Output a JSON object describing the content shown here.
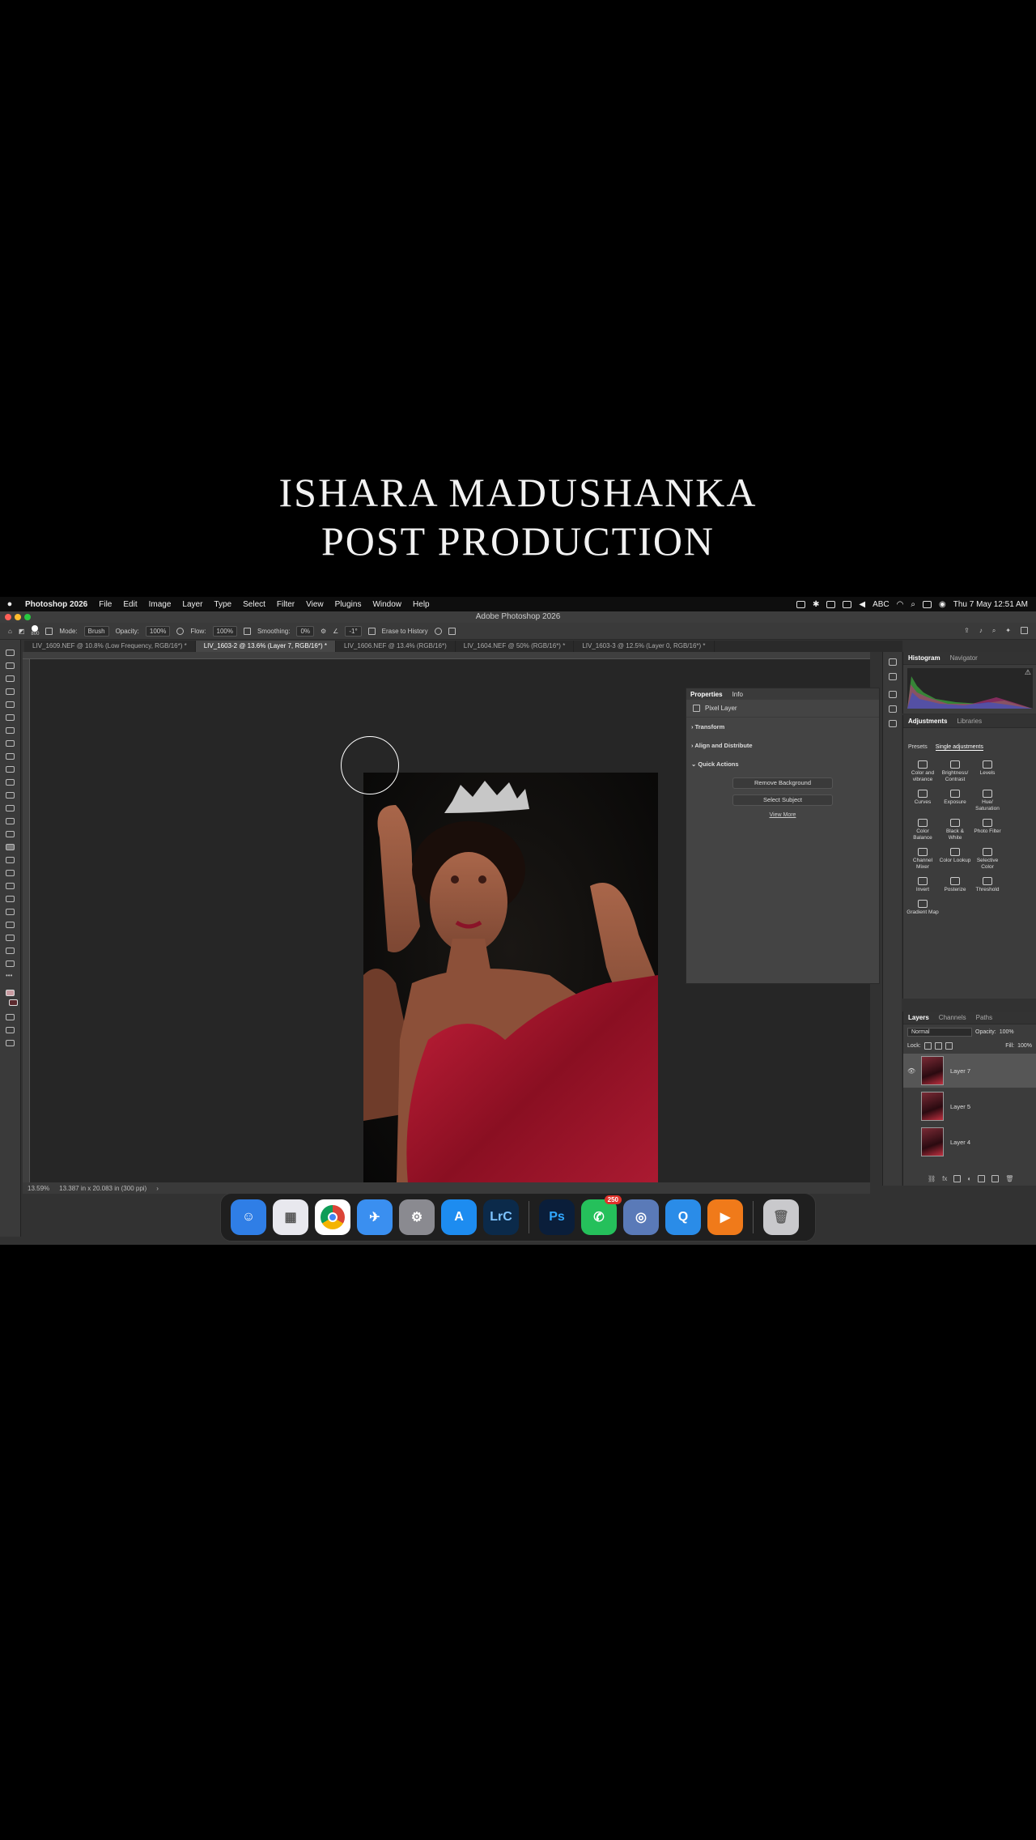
{
  "overlay": {
    "line1": "ISHARA MADUSHANKA",
    "line2": "POST PRODUCTION"
  },
  "menubar": {
    "app": "Photoshop 2026",
    "items": [
      "File",
      "Edit",
      "Image",
      "Layer",
      "Type",
      "Select",
      "Filter",
      "View",
      "Plugins",
      "Window",
      "Help"
    ],
    "status": {
      "abc": "ABC",
      "datetime": "Thu 7 May  12:51 AM"
    }
  },
  "window": {
    "title": "Adobe Photoshop 2026"
  },
  "options": {
    "brush_size": "800",
    "mode_label": "Mode:",
    "mode_value": "Brush",
    "opacity_label": "Opacity:",
    "opacity_value": "100%",
    "flow_label": "Flow:",
    "flow_value": "100%",
    "smoothing_label": "Smoothing:",
    "smoothing_value": "0%",
    "angle_value": "-1°",
    "erase_history": "Erase to History"
  },
  "tabs": [
    {
      "label": "LIV_1609.NEF @ 10.8% (Low Frequency, RGB/16*) *"
    },
    {
      "label": "LIV_1603-2 @ 13.6% (Layer 7, RGB/16*) *"
    },
    {
      "label": "LIV_1606.NEF @ 13.4% (RGB/16*)"
    },
    {
      "label": "LIV_1604.NEF @ 50% (RGB/16*) *"
    },
    {
      "label": "LIV_1603-3 @ 12.5% (Layer 0, RGB/16*) *"
    }
  ],
  "status": {
    "zoom": "13.59%",
    "doc_size": "13.387 in x 20.083 in (300 ppi)"
  },
  "properties": {
    "tab_properties": "Properties",
    "tab_info": "Info",
    "pixel_layer": "Pixel Layer",
    "transform": "Transform",
    "align": "Align and Distribute",
    "quick_actions": "Quick Actions",
    "remove_bg": "Remove Background",
    "select_subject": "Select Subject",
    "view_more": "View More"
  },
  "histogram": {
    "tab_histogram": "Histogram",
    "tab_navigator": "Navigator"
  },
  "adjustments": {
    "tab_adjustments": "Adjustments",
    "tab_libraries": "Libraries",
    "presets": "Presets",
    "single": "Single adjustments",
    "items": [
      "Color and vibrance",
      "Brightness/ Contrast",
      "Levels",
      "Curves",
      "Exposure",
      "Hue/ Saturation",
      "Color Balance",
      "Black & White",
      "Photo Filter",
      "Channel Mixer",
      "Color Lookup",
      "Selective Color",
      "Invert",
      "Posterize",
      "Threshold",
      "Gradient Map"
    ]
  },
  "layers": {
    "tab_layers": "Layers",
    "tab_channels": "Channels",
    "tab_paths": "Paths",
    "blend_mode": "Normal",
    "opacity_label": "Opacity:",
    "opacity_value": "100%",
    "lock_label": "Lock:",
    "fill_label": "Fill:",
    "fill_value": "100%",
    "items": [
      {
        "name": "Layer 7"
      },
      {
        "name": "Layer 5"
      },
      {
        "name": "Layer 4"
      }
    ]
  },
  "dock": {
    "items": [
      {
        "name": "Finder",
        "color": "#2f7ee6"
      },
      {
        "name": "Launchpad",
        "color": "#e8e8ee"
      },
      {
        "name": "Chrome",
        "color": "#ffffff"
      },
      {
        "name": "Safari",
        "color": "#3a8ff0"
      },
      {
        "name": "System Settings",
        "color": "#8a8a90"
      },
      {
        "name": "App Store",
        "color": "#1d8cf0"
      },
      {
        "name": "Lightroom Classic",
        "color": "#0b2a4a",
        "label": "LrC"
      },
      {
        "name": "Photoshop",
        "color": "#0a1e3a",
        "label": "Ps"
      },
      {
        "name": "WhatsApp",
        "color": "#25c05b",
        "badge": "250"
      },
      {
        "name": "Disk Utility",
        "color": "#5a7ab8"
      },
      {
        "name": "QuickTime",
        "color": "#2a8ce8"
      },
      {
        "name": "Infuse",
        "color": "#f07a1a"
      },
      {
        "name": "Trash",
        "color": "#c9c9cc"
      }
    ]
  }
}
